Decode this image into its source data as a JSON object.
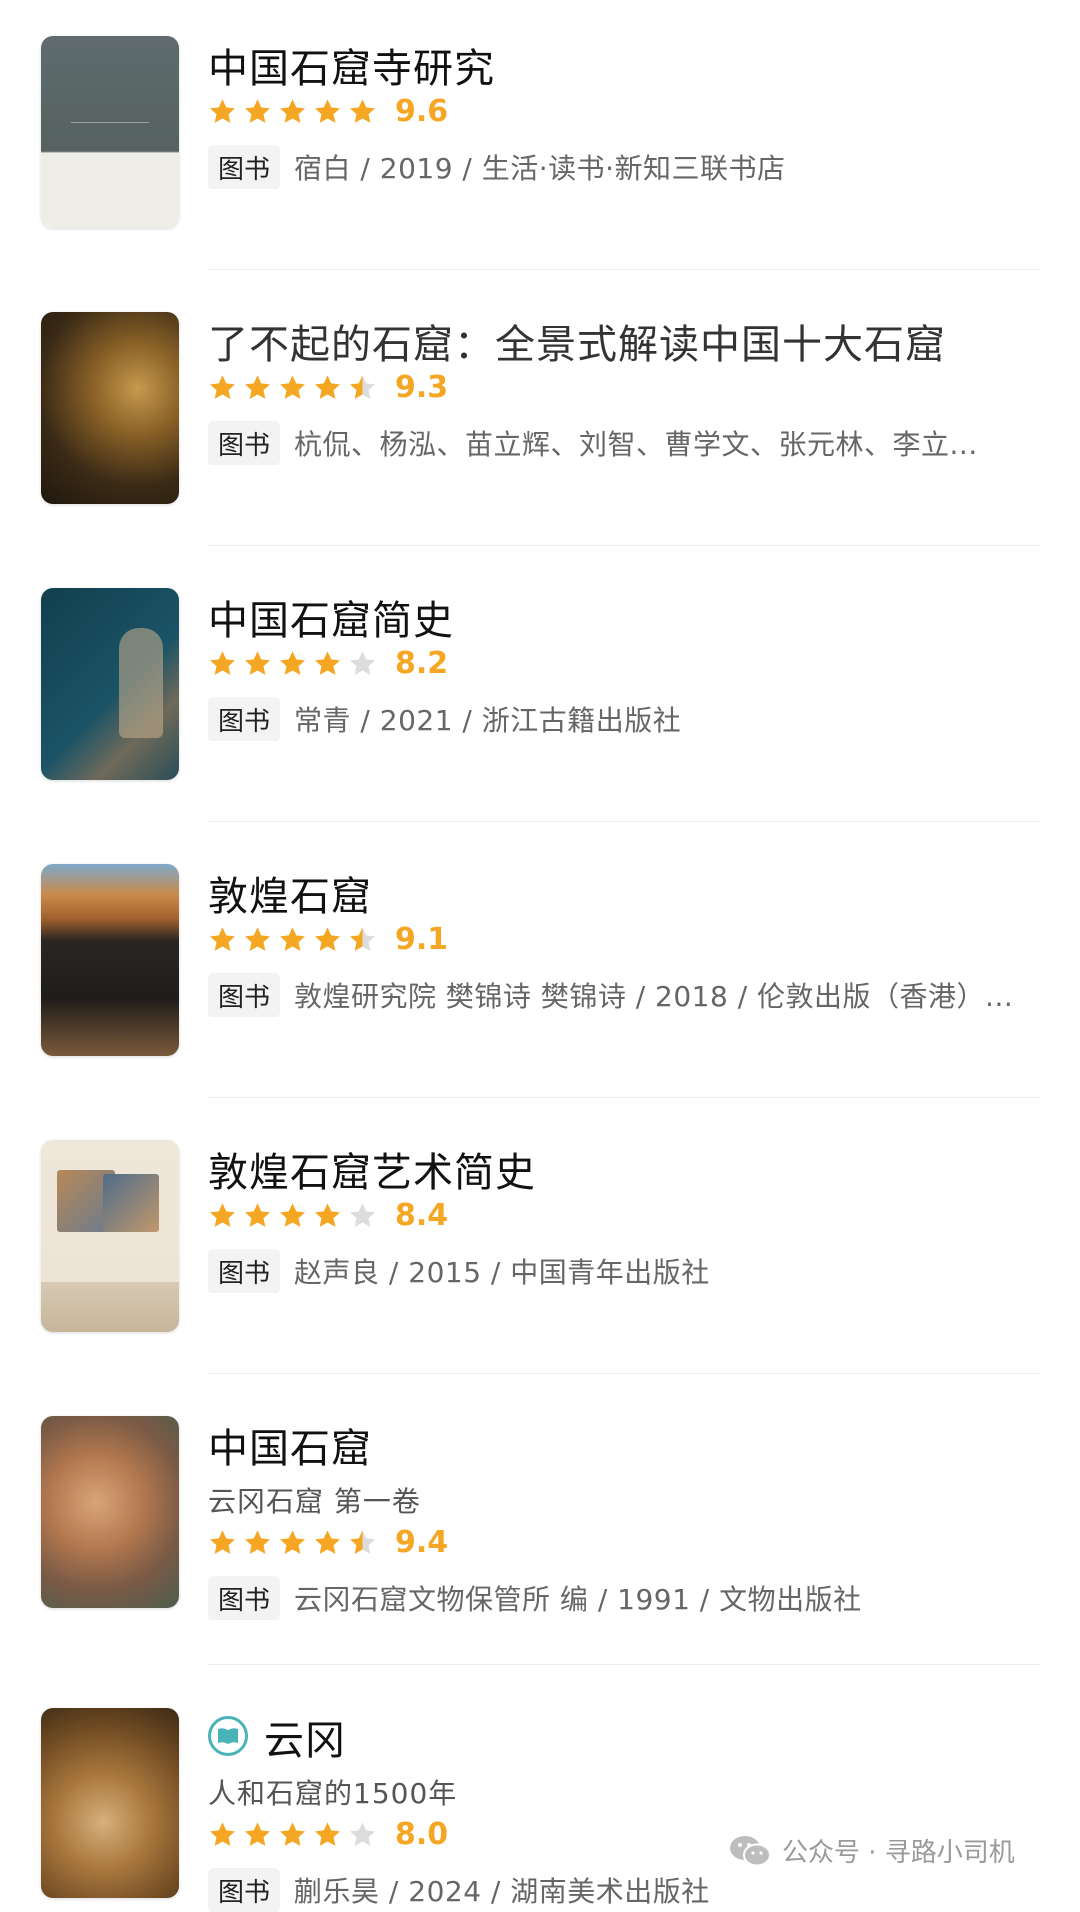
{
  "tag_label": "图书",
  "colors": {
    "star_full": "#f5a623",
    "star_empty": "#dcdcdc",
    "score": "#f5a623"
  },
  "books": [
    {
      "title": "中国石窟寺研究",
      "rating": "9.6",
      "stars": 5,
      "meta": "宿白 / 2019 / 生活·读书·新知三联书店"
    },
    {
      "title": "了不起的石窟：全景式解读中国十大石窟",
      "rating": "9.3",
      "stars": 4.5,
      "meta": "杭侃、杨泓、苗立辉、刘智、曹学文、张元林、李立..."
    },
    {
      "title": "中国石窟简史",
      "rating": "8.2",
      "stars": 4,
      "meta": "常青 / 2021 / 浙江古籍出版社"
    },
    {
      "title": "敦煌石窟",
      "rating": "9.1",
      "stars": 4.5,
      "meta": "敦煌研究院 樊锦诗 樊锦诗 / 2018 / 伦敦出版（香港）..."
    },
    {
      "title": "敦煌石窟艺术简史",
      "rating": "8.4",
      "stars": 4,
      "meta": "赵声良 / 2015 / 中国青年出版社"
    },
    {
      "title": "中国石窟",
      "subtitle": "云冈石窟 第一卷",
      "rating": "9.4",
      "stars": 4.5,
      "meta": "云冈石窟文物保管所 编 / 1991 / 文物出版社"
    },
    {
      "title": "云冈",
      "subtitle": "人和石窟的1500年",
      "rating": "8.0",
      "stars": 4,
      "meta": "蒯乐昊 / 2024 / 湖南美术出版社",
      "has_read_icon": true
    }
  ],
  "watermark": "公众号 · 寻路小司机"
}
